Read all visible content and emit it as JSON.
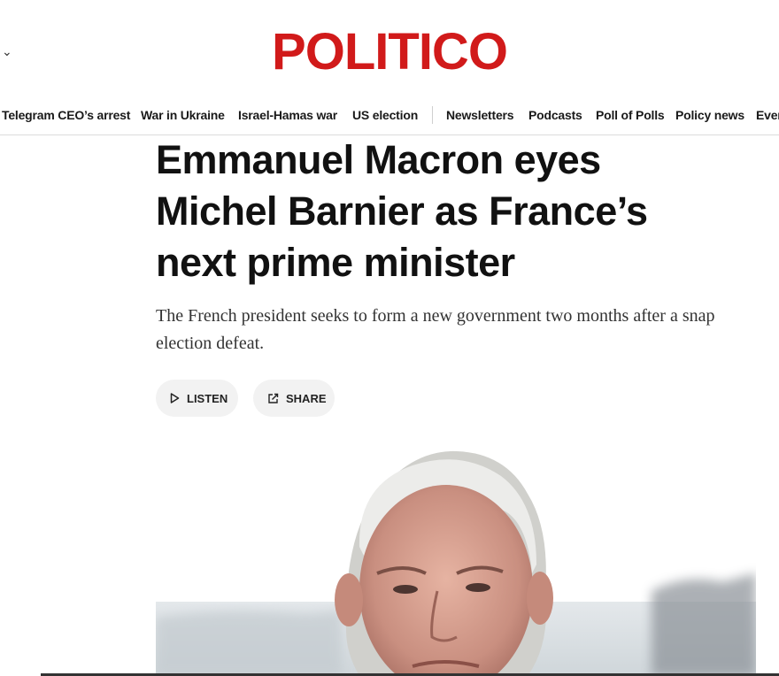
{
  "header": {
    "menu_chevron": "⌄",
    "logo_text": "POLITICO"
  },
  "nav": {
    "items": [
      {
        "label": "Telegram CEO’s arrest"
      },
      {
        "label": "War in Ukraine"
      },
      {
        "label": "Israel-Hamas war"
      },
      {
        "label": "US election"
      },
      {
        "label": "Newsletters"
      },
      {
        "label": "Podcasts"
      },
      {
        "label": "Poll of Polls"
      },
      {
        "label": "Policy news"
      },
      {
        "label": "Even"
      }
    ]
  },
  "article": {
    "headline": "Emmanuel Macron eyes Michel Barnier as France’s next prime minister",
    "dek": "The French president seeks to form a new government two months after a snap election defeat.",
    "listen_label": "LISTEN",
    "share_label": "SHARE"
  },
  "colors": {
    "brand": "#d11a1a",
    "button_bg": "#f2f2f2"
  },
  "icons": [
    "chevron-down-icon",
    "play-icon",
    "share-icon"
  ]
}
